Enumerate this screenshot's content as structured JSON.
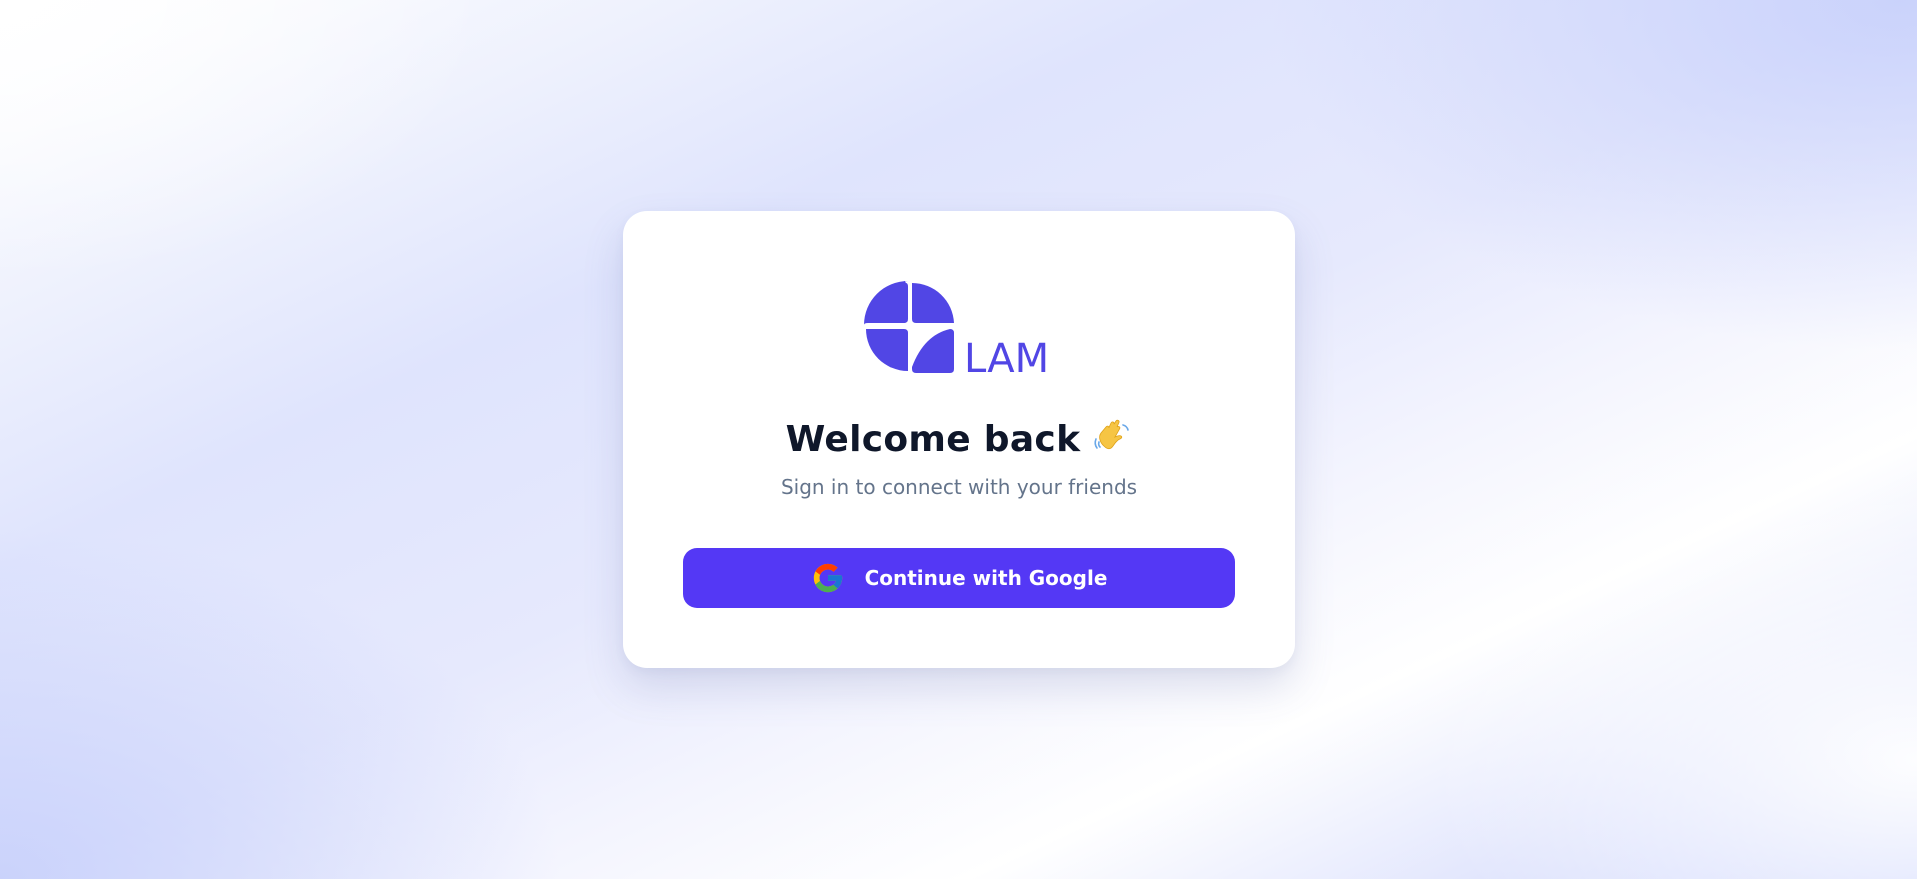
{
  "brand": {
    "logo_text": "LAM",
    "color": "#5146e5"
  },
  "login": {
    "title": "Welcome back",
    "title_emoji_icon": "waving-hand-icon",
    "subtitle": "Sign in to connect with your friends",
    "google_button_label": "Continue with Google",
    "google_icon": "google-g-icon",
    "button_color": "#5438f5"
  }
}
